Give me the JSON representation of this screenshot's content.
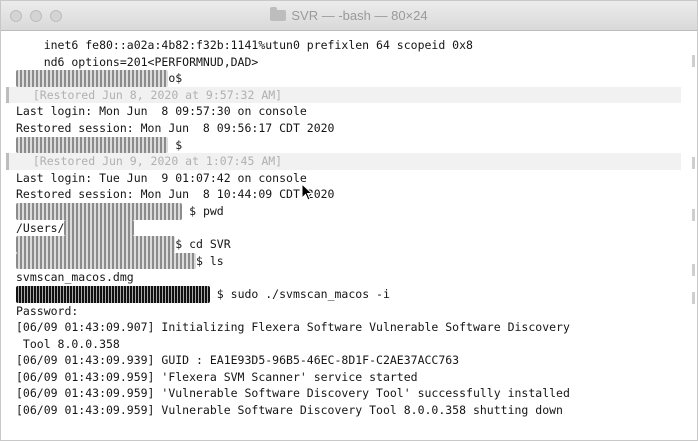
{
  "window": {
    "title": "SVR — -bash — 80×24"
  },
  "terminal": {
    "lines": [
      {
        "type": "plain",
        "text": "    inet6 fe80::a02a:4b82:f32b:1141%utun0 prefixlen 64 scopeid 0x8"
      },
      {
        "type": "plain",
        "text": "    nd6 options=201<PERFORMNUD,DAD>"
      },
      {
        "type": "prompt",
        "redacted": "xxxxxxxx xxxxxxxx xxxx",
        "text": "o$"
      },
      {
        "type": "restored",
        "text": "  [Restored Jun 8, 2020 at 9:57:32 AM]"
      },
      {
        "type": "plain",
        "text": "Last login: Mon Jun  8 09:57:30 on console"
      },
      {
        "type": "plain",
        "text": "Restored session: Mon Jun  8 09:56:17 CDT 2020"
      },
      {
        "type": "prompt",
        "redacted": "xxxxxxxx xxxxxxxx xxxx",
        "text": " $"
      },
      {
        "type": "restored",
        "text": "  [Restored Jun 9, 2020 at 1:07:45 AM]"
      },
      {
        "type": "plain",
        "text": "Last login: Tue Jun  9 01:07:42 on console"
      },
      {
        "type": "plain",
        "text": "Restored session: Mon Jun  8 10:44:09 CDT 2020"
      },
      {
        "type": "prompt",
        "redacted": "xxxxxxxx xxxxxxxx xxxxxx",
        "text": " $ pwd"
      },
      {
        "type": "prompt_path",
        "prefix": "/Users/",
        "redacted": "xxxxxxxxxx"
      },
      {
        "type": "prompt",
        "redacted": "xxxxxxxx xxxxxxxx xxxxx",
        "text": "$ cd SVR"
      },
      {
        "type": "prompt",
        "redacted": "xxxxxxxx xxxxxxxx xxxxxxxx",
        "text": "$ ls"
      },
      {
        "type": "plain",
        "text": "svmscan_macos.dmg"
      },
      {
        "type": "prompt_dark",
        "redacted": "xxxxxxxxxx xxxxxxxxx xxxxxxx",
        "text": " $ sudo ./svmscan_macos -i"
      },
      {
        "type": "plain",
        "text": "Password:"
      },
      {
        "type": "plain",
        "text": "[06/09 01:43:09.907] Initializing Flexera Software Vulnerable Software Discovery"
      },
      {
        "type": "plain",
        "text": " Tool 8.0.0.358"
      },
      {
        "type": "plain",
        "text": "[06/09 01:43:09.939] GUID : EA1E93D5-96B5-46EC-8D1F-C2AE37ACC763"
      },
      {
        "type": "plain",
        "text": "[06/09 01:43:09.959] 'Flexera SVM Scanner' service started"
      },
      {
        "type": "plain",
        "text": "[06/09 01:43:09.959] 'Vulnerable Software Discovery Tool' successfully installed"
      },
      {
        "type": "plain",
        "text": "[06/09 01:43:09.959] Vulnerable Software Discovery Tool 8.0.0.358 shutting down"
      }
    ]
  }
}
